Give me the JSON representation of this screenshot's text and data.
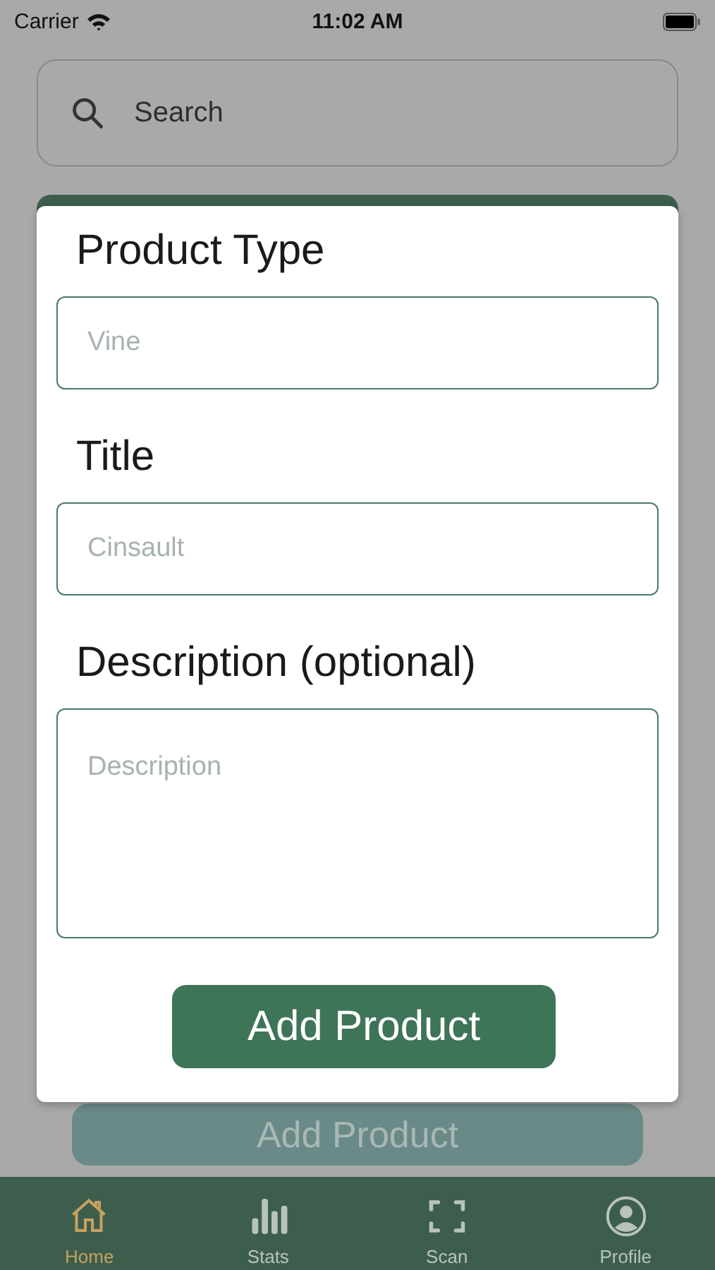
{
  "status_bar": {
    "carrier": "Carrier",
    "time": "11:02 AM"
  },
  "search": {
    "placeholder": "Search"
  },
  "background_button": "Add Product",
  "modal": {
    "fields": [
      {
        "label": "Product Type",
        "placeholder": "Vine",
        "kind": "line"
      },
      {
        "label": "Title",
        "placeholder": "Cinsault",
        "kind": "line"
      },
      {
        "label": "Description (optional)",
        "placeholder": "Description",
        "kind": "multiline"
      }
    ],
    "button": "Add Product"
  },
  "tabs": [
    {
      "label": "Home",
      "kind": "home",
      "selected": true
    },
    {
      "label": "Stats",
      "kind": "stats",
      "selected": false
    },
    {
      "label": "Scan",
      "kind": "scan",
      "selected": false
    },
    {
      "label": "Profile",
      "kind": "profile",
      "selected": false
    }
  ]
}
